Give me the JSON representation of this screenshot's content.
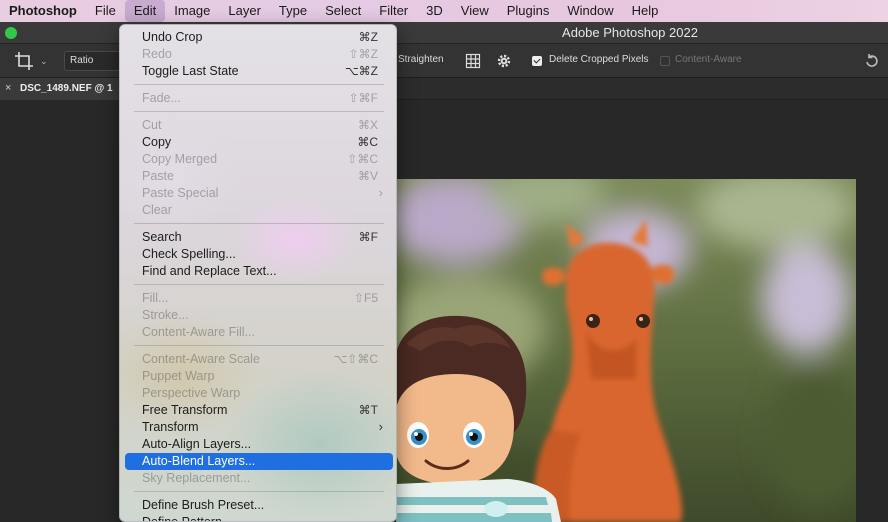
{
  "menubar": {
    "items": [
      {
        "label": "Photoshop",
        "app": true
      },
      {
        "label": "File"
      },
      {
        "label": "Edit",
        "active": true
      },
      {
        "label": "Image"
      },
      {
        "label": "Layer"
      },
      {
        "label": "Type"
      },
      {
        "label": "Select"
      },
      {
        "label": "Filter"
      },
      {
        "label": "3D"
      },
      {
        "label": "View"
      },
      {
        "label": "Plugins"
      },
      {
        "label": "Window"
      },
      {
        "label": "Help"
      }
    ]
  },
  "window": {
    "title": "Adobe Photoshop 2022"
  },
  "options": {
    "ratio": "Ratio",
    "straighten": "Straighten",
    "delete_cropped": "Delete Cropped Pixels",
    "delete_cropped_checked": true,
    "content_aware": "Content-Aware",
    "content_aware_checked": false
  },
  "document": {
    "tab_name": "DSC_1489.NEF @ 1",
    "close_glyph": "×"
  },
  "edit_menu": {
    "items": [
      {
        "label": "Undo Crop",
        "shortcut": "⌘Z",
        "enabled": true
      },
      {
        "label": "Redo",
        "shortcut": "⇧⌘Z",
        "enabled": false
      },
      {
        "label": "Toggle Last State",
        "shortcut": "⌥⌘Z",
        "enabled": true
      },
      {
        "sep": true
      },
      {
        "label": "Fade...",
        "shortcut": "⇧⌘F",
        "enabled": false
      },
      {
        "sep": true
      },
      {
        "label": "Cut",
        "shortcut": "⌘X",
        "enabled": false
      },
      {
        "label": "Copy",
        "shortcut": "⌘C",
        "enabled": true
      },
      {
        "label": "Copy Merged",
        "shortcut": "⇧⌘C",
        "enabled": false
      },
      {
        "label": "Paste",
        "shortcut": "⌘V",
        "enabled": false
      },
      {
        "label": "Paste Special",
        "shortcut": "",
        "enabled": false,
        "submenu": true
      },
      {
        "label": "Clear",
        "shortcut": "",
        "enabled": false
      },
      {
        "sep": true
      },
      {
        "label": "Search",
        "shortcut": "⌘F",
        "enabled": true
      },
      {
        "label": "Check Spelling...",
        "shortcut": "",
        "enabled": true
      },
      {
        "label": "Find and Replace Text...",
        "shortcut": "",
        "enabled": true
      },
      {
        "sep": true
      },
      {
        "label": "Fill...",
        "shortcut": "⇧F5",
        "enabled": false
      },
      {
        "label": "Stroke...",
        "shortcut": "",
        "enabled": false
      },
      {
        "label": "Content-Aware Fill...",
        "shortcut": "",
        "enabled": false
      },
      {
        "sep": true
      },
      {
        "label": "Content-Aware Scale",
        "shortcut": "⌥⇧⌘C",
        "enabled": false
      },
      {
        "label": "Puppet Warp",
        "shortcut": "",
        "enabled": false
      },
      {
        "label": "Perspective Warp",
        "shortcut": "",
        "enabled": false
      },
      {
        "label": "Free Transform",
        "shortcut": "⌘T",
        "enabled": true
      },
      {
        "label": "Transform",
        "shortcut": "",
        "enabled": true,
        "submenu": true
      },
      {
        "label": "Auto-Align Layers...",
        "shortcut": "",
        "enabled": true
      },
      {
        "label": "Auto-Blend Layers...",
        "shortcut": "",
        "enabled": true,
        "highlighted": true
      },
      {
        "label": "Sky Replacement...",
        "shortcut": "",
        "enabled": false
      },
      {
        "sep": true
      },
      {
        "label": "Define Brush Preset...",
        "shortcut": "",
        "enabled": true
      },
      {
        "label": "Define Pattern...",
        "shortcut": "",
        "enabled": true
      }
    ]
  }
}
